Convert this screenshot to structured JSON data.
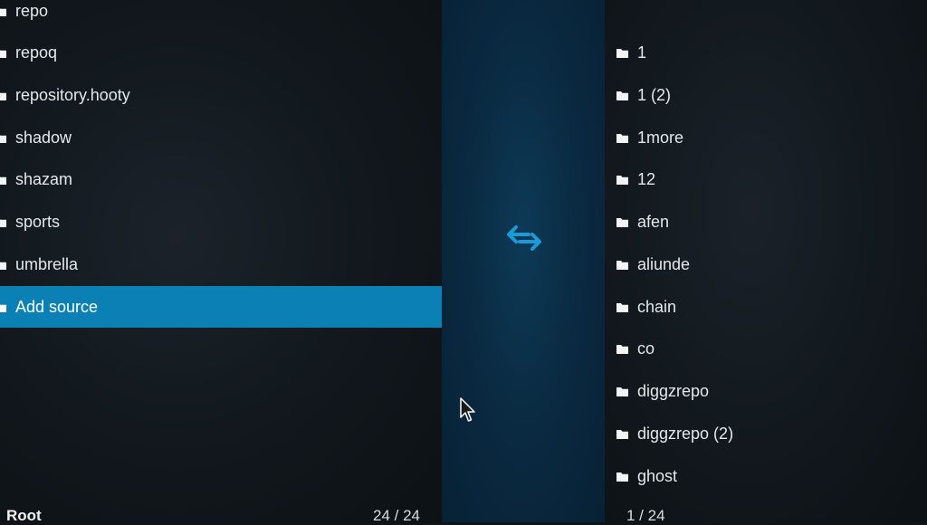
{
  "left_pane": {
    "items": [
      {
        "label": "repo"
      },
      {
        "label": "repoq"
      },
      {
        "label": "repository.hooty"
      },
      {
        "label": "shadow"
      },
      {
        "label": "shazam"
      },
      {
        "label": "sports"
      },
      {
        "label": "umbrella"
      },
      {
        "label": "Add source",
        "selected": true
      }
    ],
    "footer_title": "Root",
    "footer_count": "24 / 24"
  },
  "right_pane": {
    "items": [
      {
        "label": "1"
      },
      {
        "label": "1 (2)"
      },
      {
        "label": "1more"
      },
      {
        "label": "12"
      },
      {
        "label": "afen"
      },
      {
        "label": "aliunde"
      },
      {
        "label": "chain"
      },
      {
        "label": "co"
      },
      {
        "label": "diggzrepo"
      },
      {
        "label": "diggzrepo (2)"
      },
      {
        "label": "ghost"
      }
    ],
    "footer_count": "1 / 24"
  },
  "icons": {
    "folder": "folder-icon",
    "swap": "swap-arrows-icon",
    "cursor": "mouse-pointer-icon"
  },
  "colors": {
    "selection": "#0a80b4",
    "accent": "#1a9ad6",
    "center_strip": "#0a2b42"
  }
}
